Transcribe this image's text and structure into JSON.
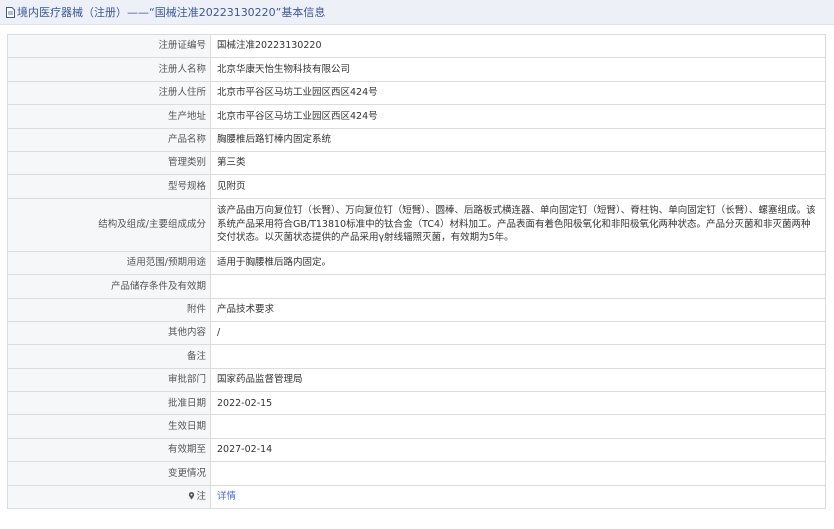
{
  "header": {
    "title": "境内医疗器械（注册）——“国械注准20223130220”基本信息"
  },
  "rows": [
    {
      "label": "注册证编号",
      "value": "国械注准20223130220"
    },
    {
      "label": "注册人名称",
      "value": "北京华康天怡生物科技有限公司"
    },
    {
      "label": "注册人住所",
      "value": "北京市平谷区马坊工业园区西区424号"
    },
    {
      "label": "生产地址",
      "value": "北京市平谷区马坊工业园区西区424号"
    },
    {
      "label": "产品名称",
      "value": "胸腰椎后路钉棒内固定系统"
    },
    {
      "label": "管理类别",
      "value": "第三类"
    },
    {
      "label": "型号规格",
      "value": "见附页"
    },
    {
      "label": "结构及组成/主要组成成分",
      "value": "该产品由万向复位钉（长臂）、万向复位钉（短臂）、圆棒、后路板式横连器、单向固定钉（短臂）、脊柱钩、单向固定钉（长臂）、螺塞组成。该系统产品采用符合GB/T13810标准中的钛合金（TC4）材料加工。产品表面有着色阳极氧化和非阳极氧化两种状态。产品分灭菌和非灭菌两种交付状态。以灭菌状态提供的产品采用γ射线辐照灭菌，有效期为5年。"
    },
    {
      "label": "适用范围/预期用途",
      "value": "适用于胸腰椎后路内固定。"
    },
    {
      "label": "产品储存条件及有效期",
      "value": ""
    },
    {
      "label": "附件",
      "value": "产品技术要求"
    },
    {
      "label": "其他内容",
      "value": "/"
    },
    {
      "label": "备注",
      "value": ""
    },
    {
      "label": "审批部门",
      "value": "国家药品监督管理局"
    },
    {
      "label": "批准日期",
      "value": "2022-02-15"
    },
    {
      "label": "生效日期",
      "value": ""
    },
    {
      "label": "有效期至",
      "value": "2027-02-14"
    },
    {
      "label": "变更情况",
      "value": ""
    },
    {
      "label": "注",
      "value": "详情",
      "icon": "location-pin-icon"
    }
  ]
}
